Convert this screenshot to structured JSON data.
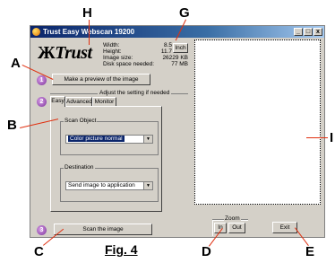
{
  "window": {
    "title": "Trust Easy Webscan 19200",
    "min": "_",
    "max": "□",
    "close": "x"
  },
  "logo": {
    "mark": "Ж",
    "text": "Trust"
  },
  "info": {
    "width_label": "Width:",
    "width_value": "8.5",
    "height_label": "Height:",
    "height_value": "11.7",
    "unit_button": "Inch",
    "image_size_label": "Image size:",
    "image_size_value": "26229 KB",
    "disk_label": "Disk space needed:",
    "disk_value": "77 MB"
  },
  "steps": {
    "one": "1",
    "two": "2",
    "three": "3"
  },
  "preview_button": "Make a preview of the image",
  "adjust_text": "Adjust the setting if needed",
  "tabs": [
    "Easy",
    "Advanced",
    "Monitor"
  ],
  "scan_object": {
    "label": "Scan Object",
    "value": "Color picture normal"
  },
  "destination": {
    "label": "Destination",
    "value": "Send image to application"
  },
  "scan_button": "Scan the image",
  "zoom": {
    "label": "Zoom",
    "in": "In",
    "out": "Out"
  },
  "exit_button": "Exit",
  "callouts": {
    "A": "A",
    "B": "B",
    "C": "C",
    "D": "D",
    "E": "E",
    "G": "G",
    "H": "H",
    "I": "I"
  },
  "figure_caption": "Fig. 4",
  "colors": {
    "titlebar": "#0a246a",
    "callout_line": "#e03010",
    "step_circle": "#7a2f99"
  }
}
